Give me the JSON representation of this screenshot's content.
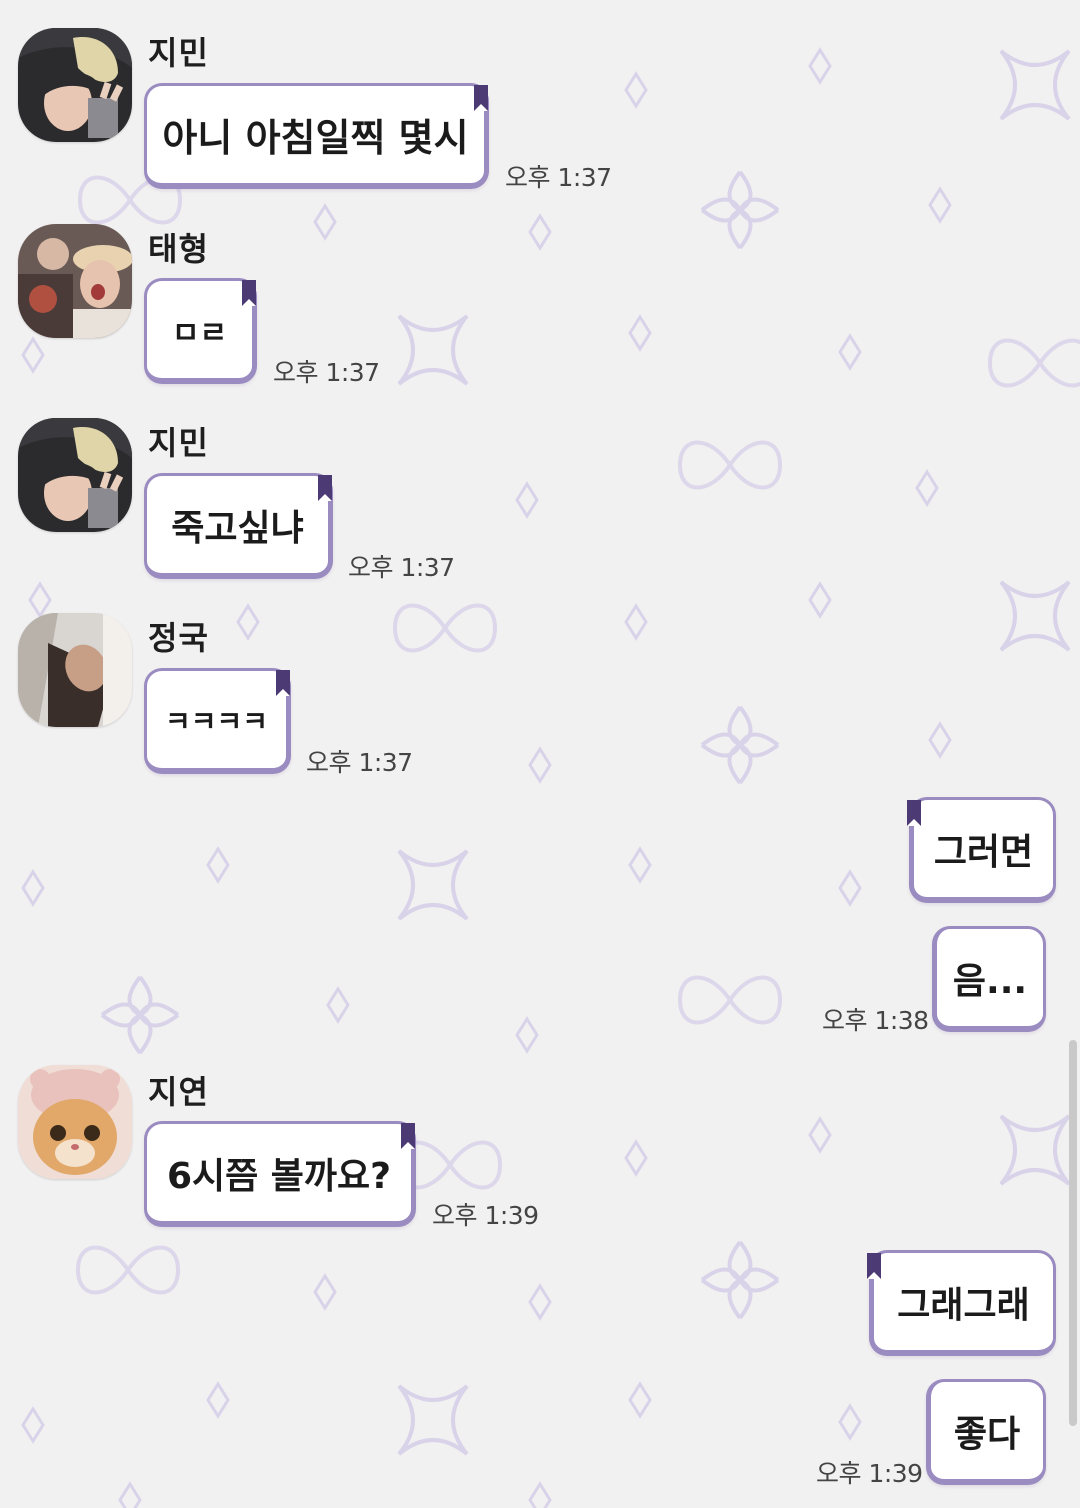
{
  "chat": {
    "messages": [
      {
        "sender": "지민",
        "text": "아니 아침일찍 몇시",
        "time": "오후 1:37"
      },
      {
        "sender": "태형",
        "text": "ㅁㄹ",
        "time": "오후 1:37"
      },
      {
        "sender": "지민",
        "text": "죽고싶냐",
        "time": "오후 1:37"
      },
      {
        "sender": "정국",
        "text": "ㅋㅋㅋㅋ",
        "time": "오후 1:37"
      },
      {
        "sender": "me",
        "text": "그러면",
        "time": ""
      },
      {
        "sender": "me",
        "text": "음...",
        "time": "오후 1:38"
      },
      {
        "sender": "지연",
        "text": "6시쯤 볼까요?",
        "time": "오후 1:39"
      },
      {
        "sender": "me",
        "text": "그래그래",
        "time": ""
      },
      {
        "sender": "me",
        "text": "좋다",
        "time": "오후 1:39"
      }
    ]
  },
  "theme": {
    "background": "#f2f1f1",
    "bubble_border": "#9a8bc0",
    "tag_color": "#4b3a73",
    "pattern_color": "#d9d3ea"
  },
  "icons": [
    "avatar-jimin-icon",
    "avatar-taehyung-icon",
    "avatar-jungkook-icon",
    "avatar-jiyeon-cat-icon",
    "bookmark-tag-icon"
  ]
}
